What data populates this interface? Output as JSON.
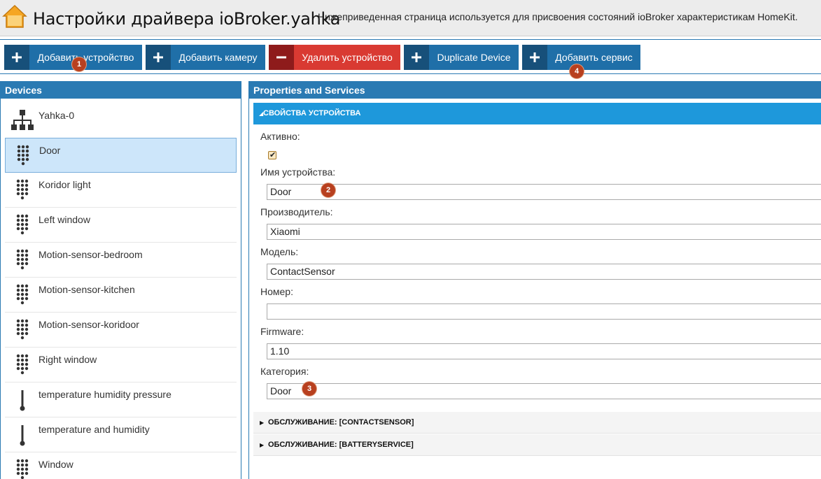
{
  "header": {
    "title": "Настройки драйвера ioBroker.yahka",
    "description": "Нижеприведенная страница используется для присвоения состояний ioBroker характеристикам HomeKit."
  },
  "toolbar": {
    "buttons": [
      {
        "label": "Добавить устройство",
        "icon": "plus-icon"
      },
      {
        "label": "Добавить камеру",
        "icon": "plus-icon"
      },
      {
        "label": "Удалить устройство",
        "icon": "minus-icon"
      },
      {
        "label": "Duplicate Device",
        "icon": "plus-icon"
      },
      {
        "label": "Добавить сервис",
        "icon": "plus-icon"
      }
    ]
  },
  "badges": [
    "1",
    "2",
    "3",
    "4"
  ],
  "devices": {
    "title": "Devices",
    "items": [
      {
        "label": "Yahka-0",
        "icon": "hierarchy-icon"
      },
      {
        "label": "Door",
        "icon": "dots-grid-icon"
      },
      {
        "label": "Koridor light",
        "icon": "dots-grid-icon"
      },
      {
        "label": "Left window",
        "icon": "dots-grid-icon"
      },
      {
        "label": "Motion-sensor-bedroom",
        "icon": "dots-grid-icon"
      },
      {
        "label": "Motion-sensor-kitchen",
        "icon": "dots-grid-icon"
      },
      {
        "label": "Motion-sensor-koridoor",
        "icon": "dots-grid-icon"
      },
      {
        "label": "Right window",
        "icon": "dots-grid-icon"
      },
      {
        "label": "temperature humidity pressure",
        "icon": "thermometer-icon"
      },
      {
        "label": "temperature and humidity",
        "icon": "thermometer-icon"
      },
      {
        "label": "Window",
        "icon": "dots-grid-icon"
      }
    ],
    "selected": "Door"
  },
  "properties": {
    "title": "Properties and Services",
    "section_title": "СВОЙСТВА УСТРОЙСТВА",
    "active_label": "Активно:",
    "active_checked": true,
    "fields": {
      "name_label": "Имя устройства:",
      "name_value": "Door",
      "manufacturer_label": "Производитель:",
      "manufacturer_value": "Xiaomi",
      "model_label": "Модель:",
      "model_value": "ContactSensor",
      "serial_label": "Номер:",
      "serial_value": "",
      "firmware_label": "Firmware:",
      "firmware_value": "1.10",
      "category_label": "Категория:",
      "category_value": "Door"
    },
    "services": [
      "ОБСЛУЖИВАНИЕ: [CONTACTSENSOR]",
      "ОБСЛУЖИВАНИЕ: [BATTERYSERVICE]"
    ]
  },
  "colors": {
    "panel_blue": "#2a7ab3",
    "button_blue": "#1f6fa8",
    "button_red": "#d93a32",
    "accent_header": "#1e98db",
    "badge": "#b8401f",
    "selected_bg": "#cde6fa"
  }
}
